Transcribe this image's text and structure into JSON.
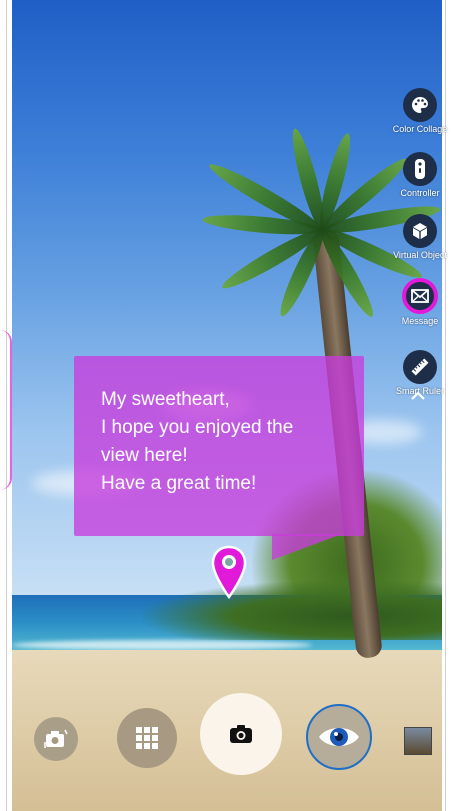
{
  "message": {
    "lines": [
      "My sweetheart,",
      "I hope you enjoyed the",
      "view here!",
      "Have a great time!"
    ]
  },
  "tools": [
    {
      "label": "Color Collage",
      "icon": "palette-icon",
      "selected": false
    },
    {
      "label": "Controller",
      "icon": "controller-icon",
      "selected": false
    },
    {
      "label": "Virtual Object",
      "icon": "cube-icon",
      "selected": false
    },
    {
      "label": "Message",
      "icon": "mail-icon",
      "selected": true
    },
    {
      "label": "Smart Ruler",
      "icon": "ruler-icon",
      "selected": false
    }
  ],
  "bottom_bar": {
    "buttons": [
      "switch-camera-icon",
      "apps-grid-icon",
      "camera-icon",
      "eye-icon",
      "gallery-thumbnail"
    ]
  },
  "colors": {
    "accent": "#e01ad8",
    "bubble": "#c83cdc",
    "tool_bg": "#1e2d48"
  }
}
